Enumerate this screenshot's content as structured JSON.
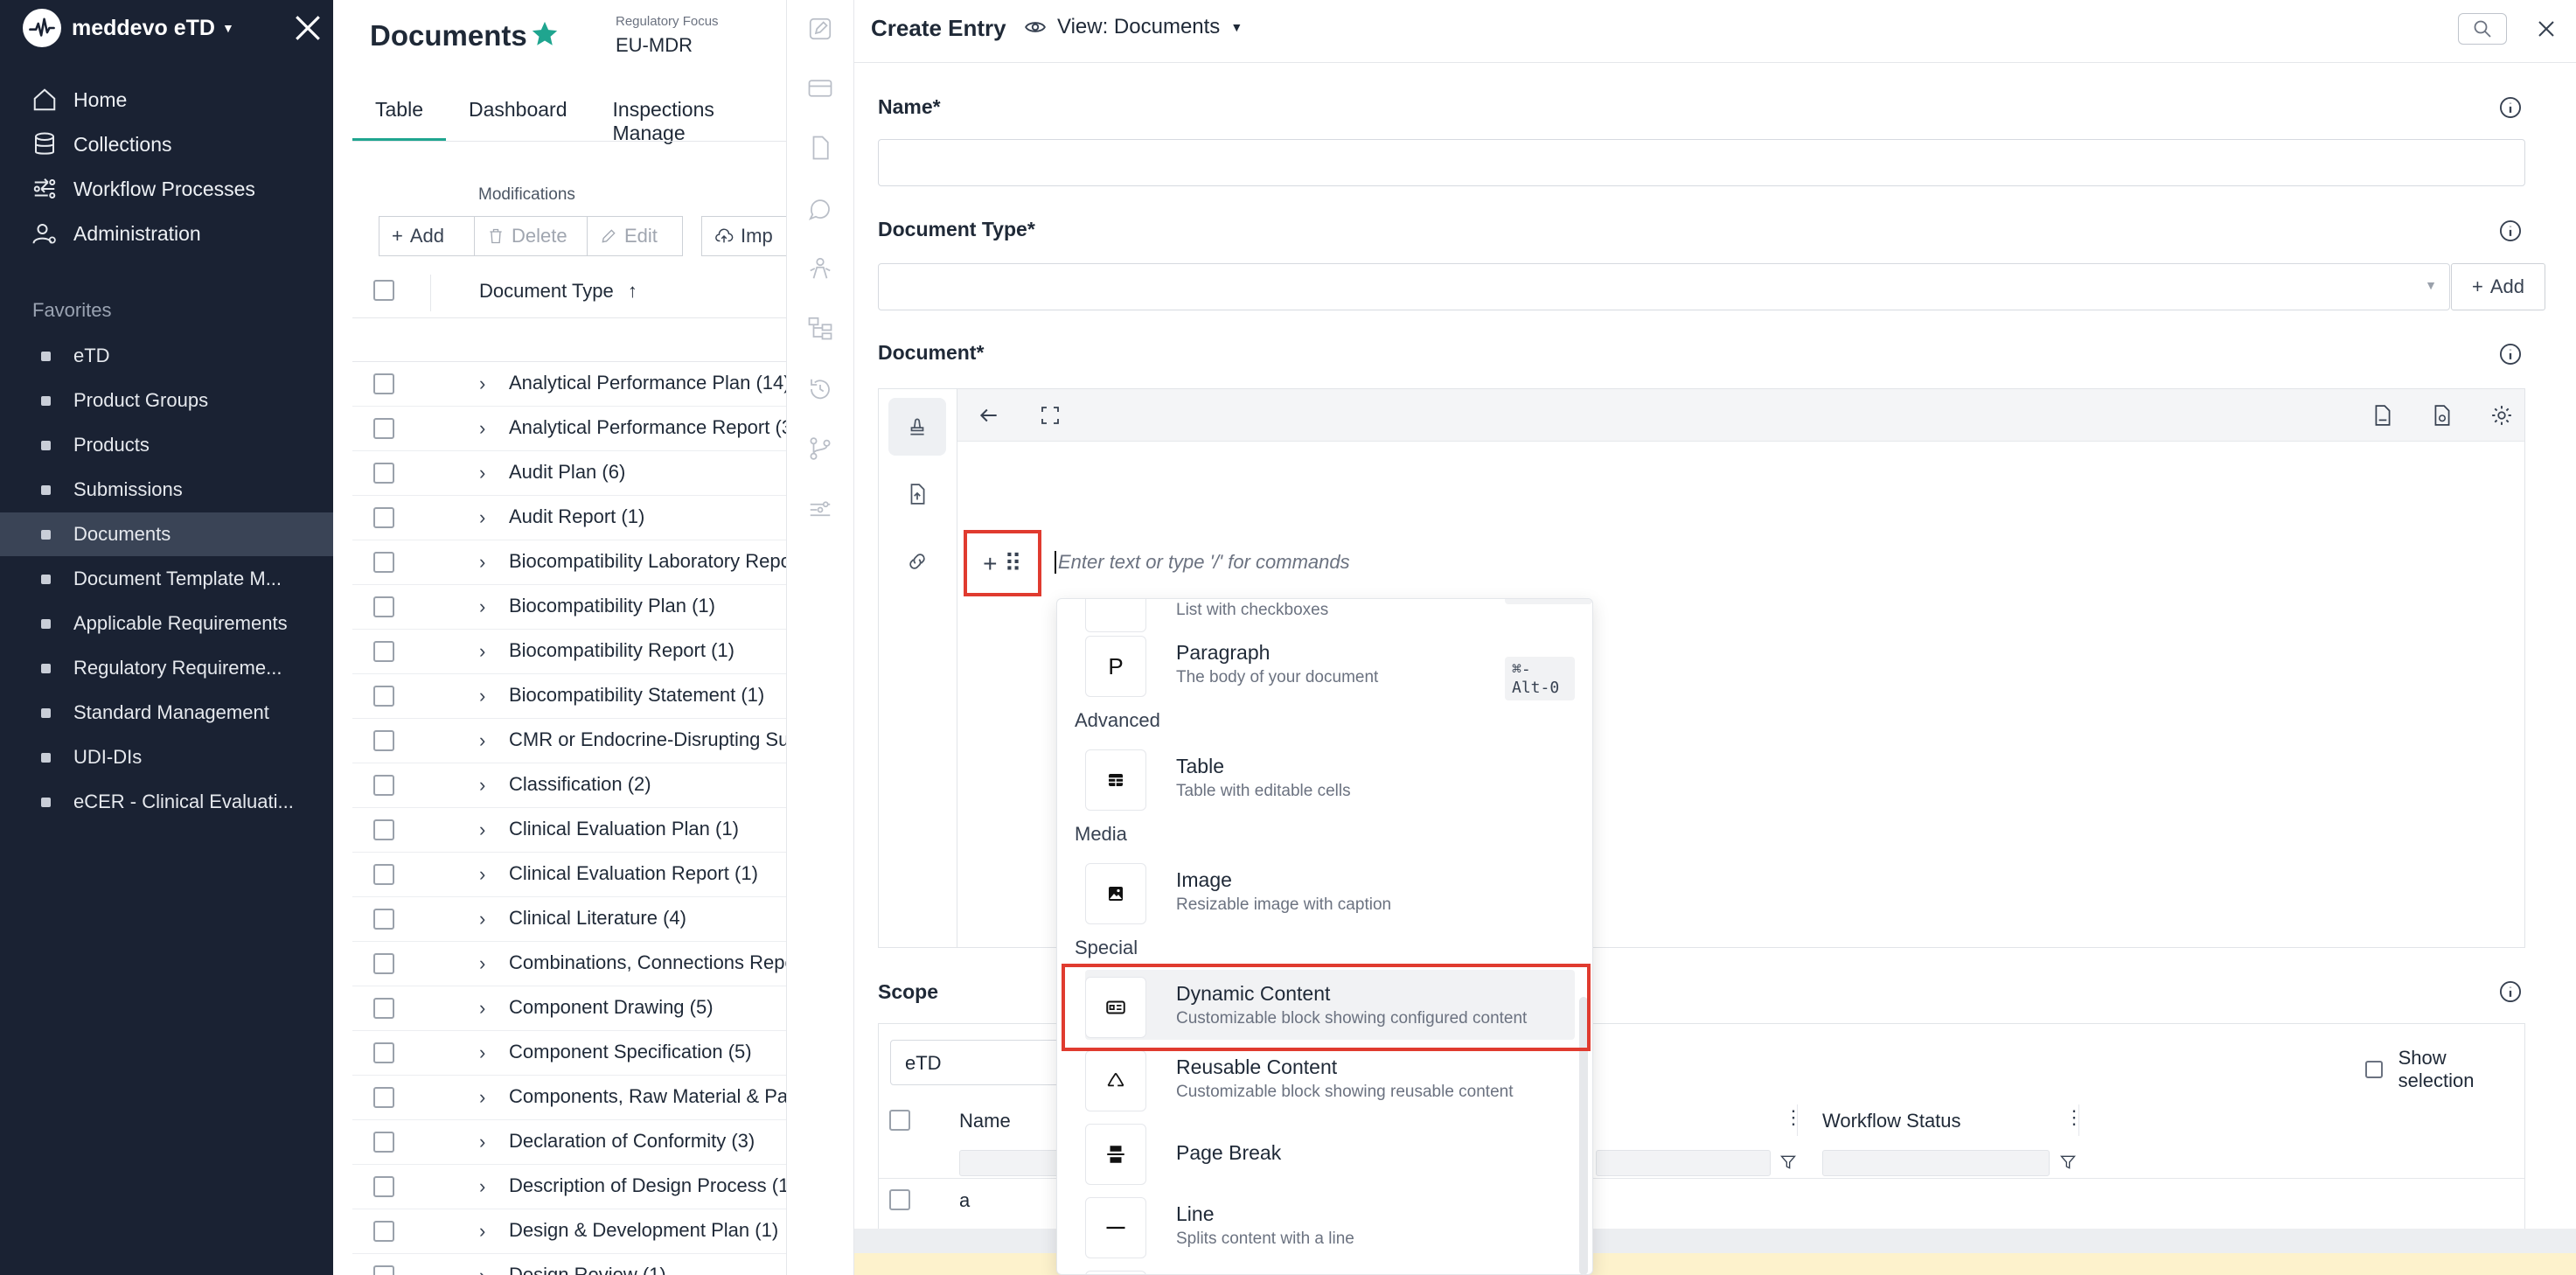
{
  "app": {
    "name": "meddevo eTD"
  },
  "sidebar": {
    "nav": [
      {
        "label": "Home",
        "icon": "home-icon"
      },
      {
        "label": "Collections",
        "icon": "database-icon"
      },
      {
        "label": "Workflow Processes",
        "icon": "workflow-icon"
      },
      {
        "label": "Administration",
        "icon": "user-gear-icon"
      }
    ],
    "favorites_heading": "Favorites",
    "favorites": [
      {
        "label": "eTD"
      },
      {
        "label": "Product Groups"
      },
      {
        "label": "Products"
      },
      {
        "label": "Submissions"
      },
      {
        "label": "Documents",
        "active": true
      },
      {
        "label": "Document Template M..."
      },
      {
        "label": "Applicable Requirements"
      },
      {
        "label": "Regulatory Requireme..."
      },
      {
        "label": "Standard Management"
      },
      {
        "label": "UDI-DIs"
      },
      {
        "label": "eCER - Clinical Evaluati..."
      }
    ]
  },
  "documents": {
    "title": "Documents",
    "regulatory_focus_label": "Regulatory Focus",
    "regulatory_focus_value": "EU-MDR",
    "tabs": [
      {
        "label": "Table",
        "active": true
      },
      {
        "label": "Dashboard"
      },
      {
        "label": "Inspections Manage"
      }
    ],
    "modifications_label": "Modifications",
    "toolbar": {
      "add": "Add",
      "delete": "Delete",
      "edit": "Edit",
      "import": "Imp"
    },
    "column_header": "Document Type",
    "sort_indicator": "↑",
    "rows": [
      "Analytical Performance Plan (14)",
      "Analytical Performance Report (3",
      "Audit Plan (6)",
      "Audit Report (1)",
      "Biocompatibility Laboratory Repo",
      "Biocompatibility Plan (1)",
      "Biocompatibility Report (1)",
      "Biocompatibility Statement (1)",
      "CMR or Endocrine-Disrupting Su",
      "Classification (2)",
      "Clinical Evaluation Plan (1)",
      "Clinical Evaluation Report (1)",
      "Clinical Literature (4)",
      "Combinations, Connections Repo",
      "Component Drawing (5)",
      "Component Specification (5)",
      "Components, Raw Material & Pac",
      "Declaration of Conformity (3)",
      "Description of Design Process (1",
      "Design & Development Plan (1)",
      "Design Review (1)"
    ]
  },
  "panel": {
    "title": "Create Entry",
    "view_label": "View: Documents",
    "fields": {
      "name_label": "Name*",
      "doctype_label": "Document Type*",
      "doctype_add": "Add",
      "document_label": "Document*",
      "scope_label": "Scope"
    },
    "editor": {
      "placeholder": "Enter text or type '/' for commands",
      "drag_symbols": "+ ⠿"
    },
    "slash_menu": {
      "partial_item_subtitle": "List with checkboxes",
      "items_top": [
        {
          "title": "Paragraph",
          "subtitle": "The body of your document",
          "shortcut": "⌘-Alt-0",
          "glyph": "P"
        }
      ],
      "groups": {
        "advanced": "Advanced",
        "media": "Media",
        "special": "Special"
      },
      "advanced_items": [
        {
          "title": "Table",
          "subtitle": "Table with editable cells",
          "icon": "table-icon"
        }
      ],
      "media_items": [
        {
          "title": "Image",
          "subtitle": "Resizable image with caption",
          "icon": "image-icon"
        }
      ],
      "special_items": [
        {
          "title": "Dynamic Content",
          "subtitle": "Customizable block showing configured content",
          "icon": "dynamic-content-icon"
        },
        {
          "title": "Reusable Content",
          "subtitle": "Customizable block showing reusable content",
          "icon": "recycle-icon"
        },
        {
          "title": "Page Break",
          "subtitle": "",
          "icon": "page-break-icon"
        },
        {
          "title": "Line",
          "subtitle": "Splits content with a line",
          "icon": "line-icon"
        }
      ]
    },
    "scope": {
      "selected": "eTD",
      "show_selection": "Show selection",
      "columns": [
        "Name",
        "Workflow Status"
      ],
      "rows": [
        {
          "name": "a"
        }
      ]
    }
  }
}
